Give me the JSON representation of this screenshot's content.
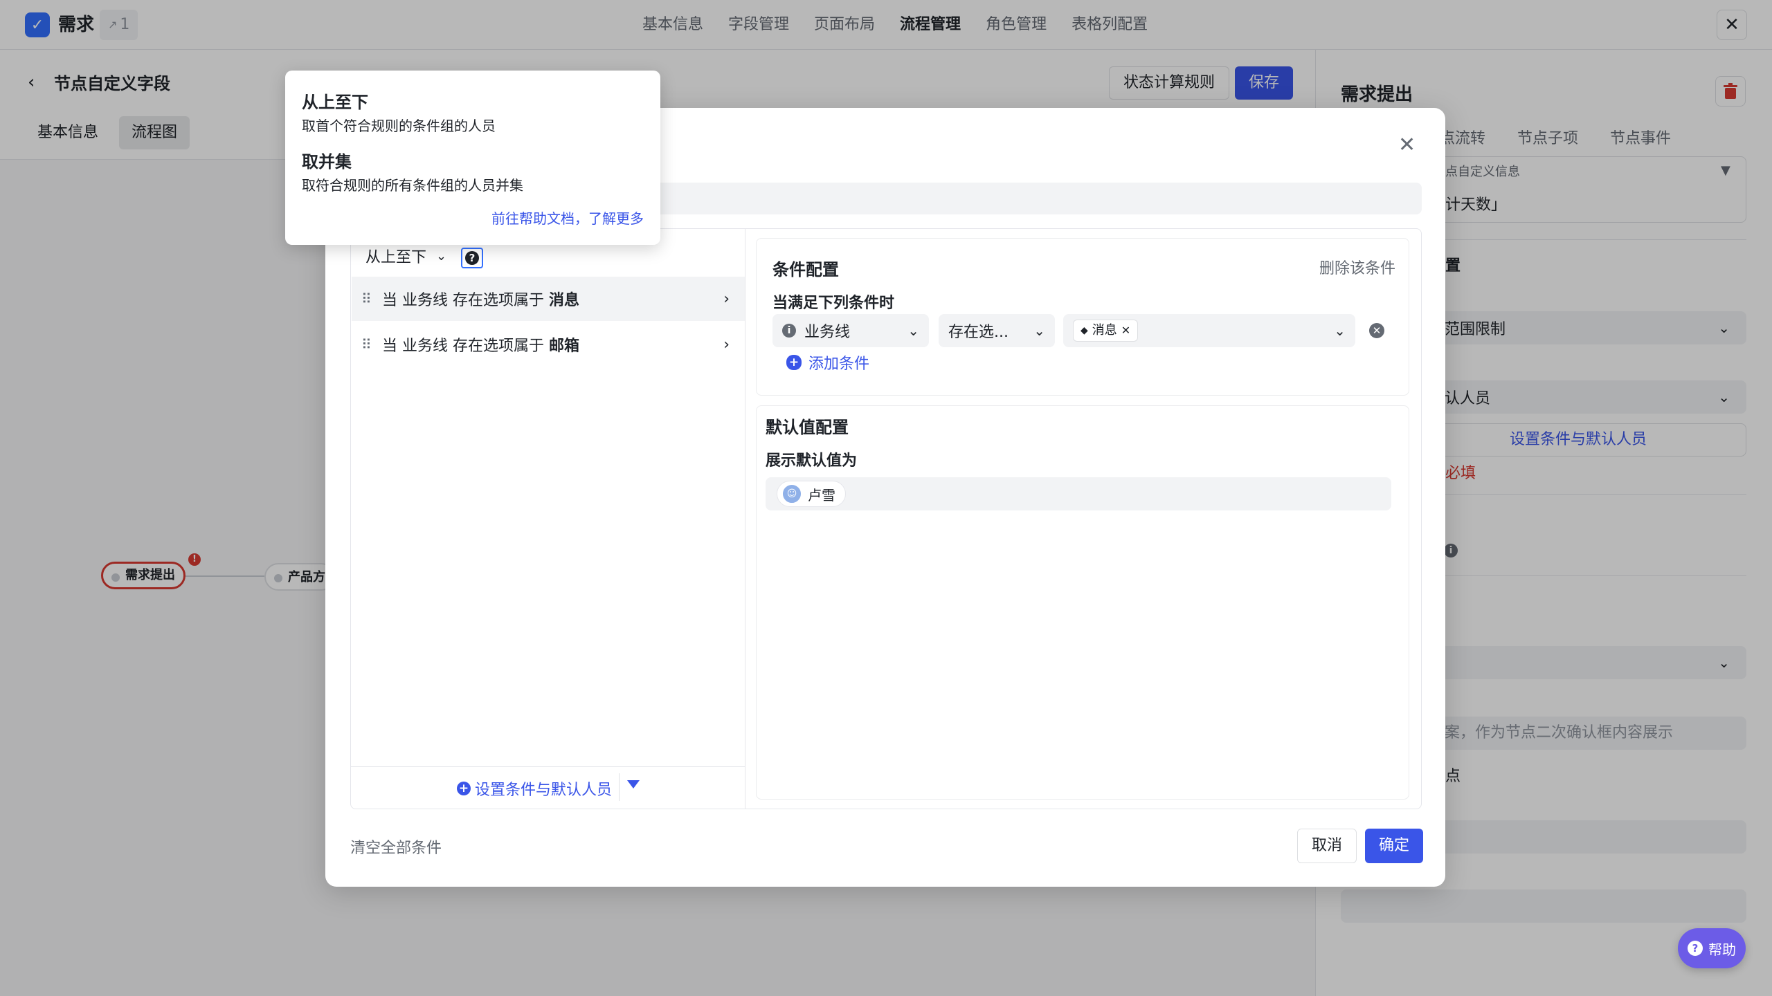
{
  "app": {
    "title": "需求",
    "sub_count": "1",
    "logo_glyph": "✓"
  },
  "top_nav": [
    {
      "label": "基本信息"
    },
    {
      "label": "字段管理"
    },
    {
      "label": "页面布局"
    },
    {
      "label": "流程管理"
    },
    {
      "label": "角色管理"
    },
    {
      "label": "表格列配置"
    }
  ],
  "top_nav_active": "流程管理",
  "page": {
    "title": "节点自定义字段",
    "tabs": [
      {
        "label": "基本信息"
      },
      {
        "label": "流程图"
      }
    ],
    "rule_button": "状态计算规则",
    "save_button": "保存"
  },
  "flow": {
    "nodes": [
      {
        "label": "需求提出"
      },
      {
        "label": "产品方"
      }
    ],
    "warning_glyph": "!"
  },
  "right_panel": {
    "title": "需求提出",
    "tabs": [
      {
        "label": "点流转"
      },
      {
        "label": "节点子项"
      },
      {
        "label": "节点事件"
      }
    ],
    "field_caption": "点自定义信息",
    "field_value": "计天数」",
    "section_partial": "置",
    "range_select": "范围限制",
    "person_select": "认人员",
    "set_link": "设置条件与默认人员",
    "required_text": "必填",
    "confirm_placeholder": "案，作为节点二次确认框内容展示",
    "small_text": "点"
  },
  "tooltip": {
    "items": [
      {
        "title": "从上至下",
        "desc": "取首个符合规则的条件组的人员"
      },
      {
        "title": "取并集",
        "desc": "取符合规则的所有条件组的人员并集"
      }
    ],
    "link": "前往帮助文档，了解更多"
  },
  "modal": {
    "sort_select": "从上至下",
    "help_glyph": "?",
    "conditions": [
      {
        "prefix": "当 业务线 存在选项属于",
        "value": "消息"
      },
      {
        "prefix": "当 业务线 存在选项属于",
        "value": "邮箱"
      }
    ],
    "add_set_button": "设置条件与默认人员",
    "condition_config": {
      "title": "条件配置",
      "delete_link": "删除该条件",
      "subtitle": "当满足下列条件时",
      "field_select": "业务线",
      "operator_select": "存在选...",
      "value_tag": "消息",
      "add_condition": "添加条件"
    },
    "default_config": {
      "title": "默认值配置",
      "subtitle": "展示默认值为",
      "person": "卢雪"
    },
    "clear_all": "清空全部条件",
    "cancel": "取消",
    "ok": "确定"
  },
  "help_button": "帮助",
  "colors": {
    "primary": "#3a55e8",
    "danger": "#d83931",
    "help": "#6c5ce7"
  }
}
